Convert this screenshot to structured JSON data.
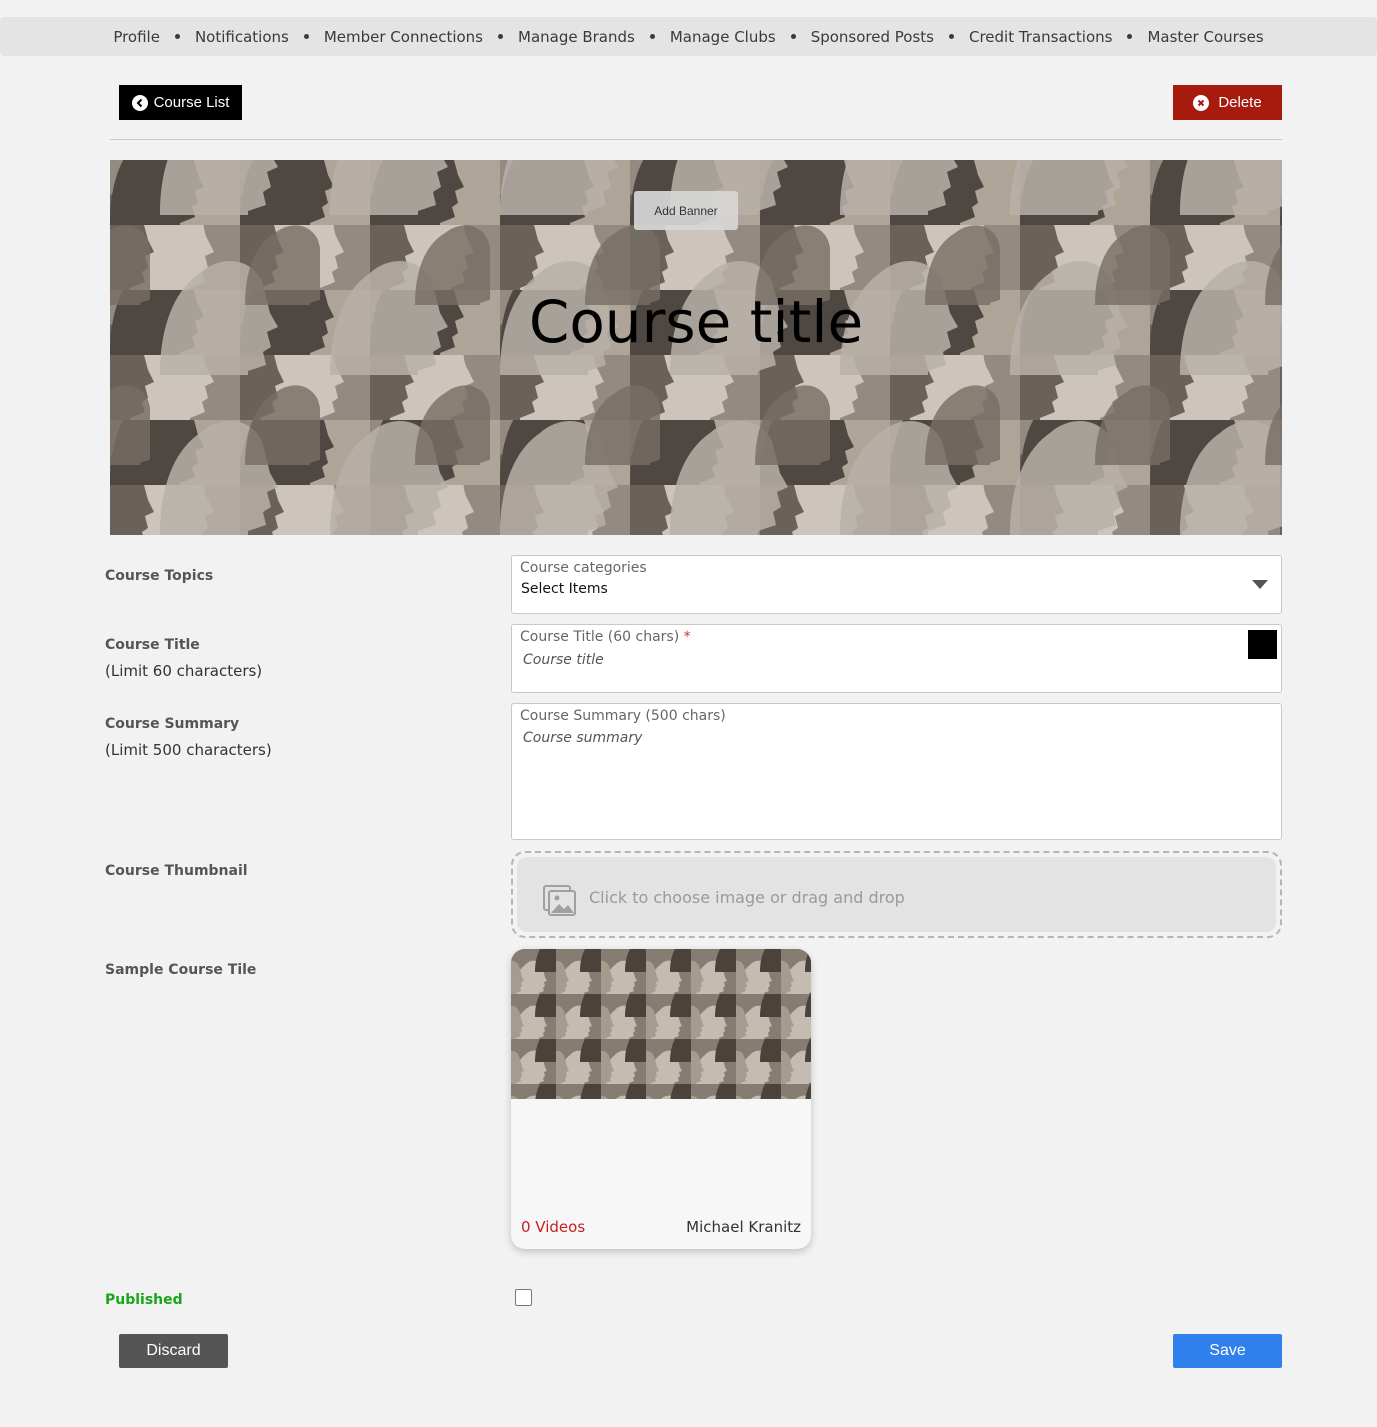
{
  "nav": {
    "items": [
      {
        "label": "Profile"
      },
      {
        "label": "Notifications"
      },
      {
        "label": "Member Connections"
      },
      {
        "label": "Manage Brands"
      },
      {
        "label": "Manage Clubs"
      },
      {
        "label": "Sponsored Posts"
      },
      {
        "label": "Credit Transactions"
      },
      {
        "label": "Master Courses"
      }
    ]
  },
  "toolbar": {
    "course_list_label": "Course List",
    "delete_label": "Delete"
  },
  "banner": {
    "add_banner_label": "Add Banner",
    "title": "Course title"
  },
  "form": {
    "topics": {
      "label": "Course Topics",
      "field_label": "Course categories",
      "value": "Select Items"
    },
    "title": {
      "label": "Course Title",
      "sublabel": "(Limit 60 characters)",
      "field_label": "Course Title (60 chars)",
      "required_mark": "*",
      "placeholder": "Course title",
      "color": "#000000"
    },
    "summary": {
      "label": "Course Summary",
      "sublabel": "(Limit 500 characters)",
      "field_label": "Course Summary (500 chars)",
      "placeholder": "Course summary"
    },
    "thumbnail": {
      "label": "Course Thumbnail",
      "dropzone_text": "Click to choose image or drag and drop",
      "icon": "image-gallery-icon"
    },
    "sample_tile": {
      "label": "Sample Course Tile",
      "videos": "0 Videos",
      "author": "Michael Kranitz"
    },
    "published": {
      "label": "Published",
      "checked": false
    }
  },
  "actions": {
    "discard_label": "Discard",
    "save_label": "Save"
  },
  "colors": {
    "delete": "#a61b0e",
    "save": "#2f80ed",
    "published": "#1aa51a",
    "videos": "#c62020"
  }
}
